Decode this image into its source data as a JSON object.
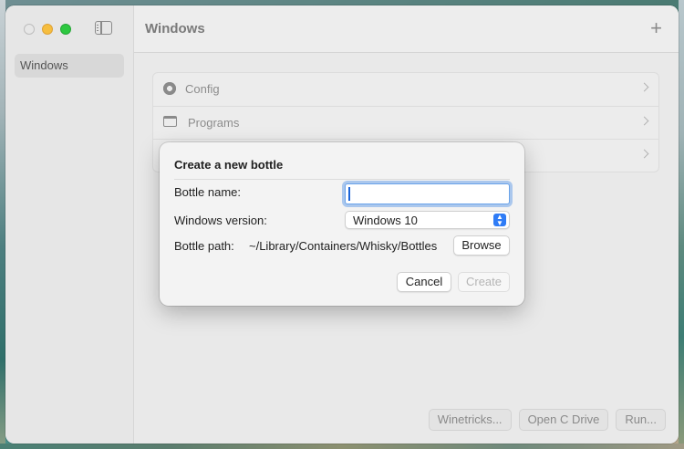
{
  "window": {
    "title": "Windows",
    "sidebar": {
      "items": [
        {
          "label": "Windows"
        }
      ]
    },
    "list": [
      {
        "label": "Config",
        "icon": "gear-icon"
      },
      {
        "label": "Programs",
        "icon": "window-icon"
      },
      {
        "label": "",
        "icon": ""
      }
    ],
    "bottom_buttons": [
      "Winetricks...",
      "Open C Drive",
      "Run..."
    ]
  },
  "dialog": {
    "title": "Create a new bottle",
    "name_label": "Bottle name:",
    "name_value": "",
    "version_label": "Windows version:",
    "version_value": "Windows 10",
    "path_label": "Bottle path:",
    "path_value": "~/Library/Containers/Whisky/Bottles",
    "browse_label": "Browse",
    "cancel_label": "Cancel",
    "create_label": "Create"
  },
  "colors": {
    "accent": "#2f7cf6",
    "traffic_close": "#e7e7e7",
    "traffic_minimize": "#f6be3f",
    "traffic_maximize": "#2dc840"
  }
}
